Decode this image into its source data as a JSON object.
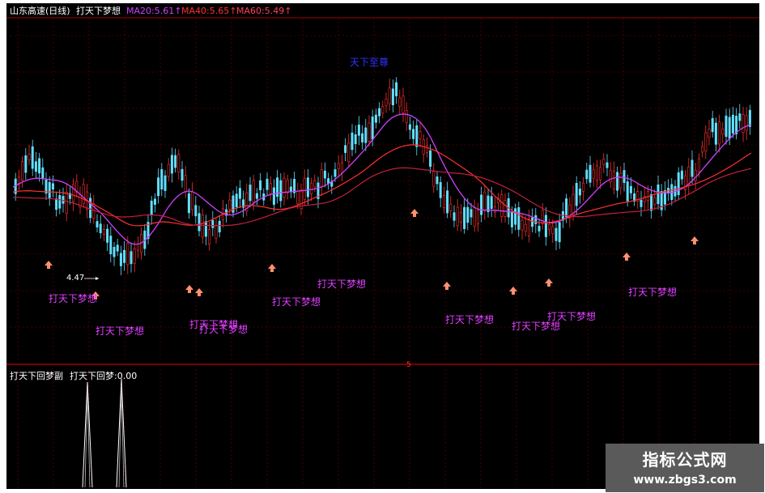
{
  "header": {
    "stock_name": "山东高速(日线)",
    "indicator_name": "打天下梦想",
    "ma20": "MA20:5.61↑",
    "ma40": "MA40:5.65↑",
    "ma60": "MA60:5.49↑"
  },
  "top_label": "天下至尊",
  "low_price_label": "4.47",
  "signal_labels": [
    "打天下梦想",
    "打天下梦想",
    "打天下梦想",
    "打天下梦想",
    "打天下梦想",
    "打天下梦想",
    "打天下梦想",
    "打天下梦想",
    "打天下梦想",
    "打天下梦想"
  ],
  "sub_panel": {
    "title_left": "打天下回梦副",
    "title_right": "打天下回梦:0.00",
    "divider_mark": "5"
  },
  "watermark": {
    "title": "指标公式网",
    "url": "www.zbgs3.com"
  },
  "colors": {
    "background": "#000000",
    "grid": "#7a0000",
    "up_candle": "#ff3030",
    "down_candle": "#60e0ff",
    "ma20": "#d040ff",
    "ma40": "#ff3030",
    "ma60": "#c02040",
    "signal_text": "#e040ff",
    "arrow": "#ff9070"
  }
}
